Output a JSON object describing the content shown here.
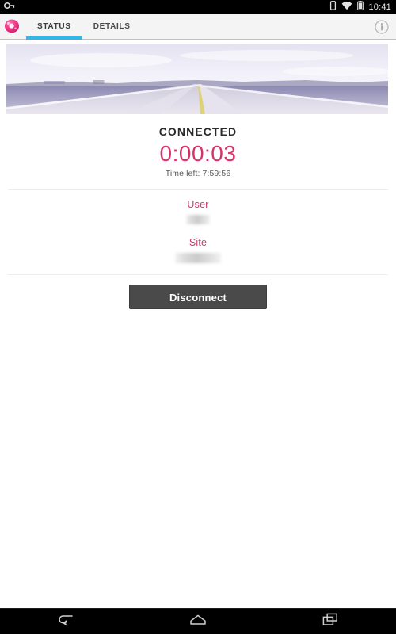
{
  "system": {
    "status_bar": {
      "left_icons": [
        {
          "name": "vpn-key-icon",
          "glyph": "vpn-key"
        }
      ],
      "right_icons": [
        {
          "name": "vibrate-mode-icon",
          "glyph": "vibrate"
        },
        {
          "name": "wifi-icon",
          "glyph": "wifi"
        },
        {
          "name": "battery-icon",
          "glyph": "battery"
        }
      ],
      "clock": "10:41"
    },
    "nav_bar": {
      "back_label": "Back",
      "home_label": "Home",
      "recents_label": "Recent apps"
    }
  },
  "app_bar": {
    "logo_name": "app-logo-icon",
    "logo_color": "#e8357f",
    "tabs": [
      {
        "label": "STATUS",
        "active": true
      },
      {
        "label": "DETAILS",
        "active": false
      }
    ],
    "info_button_label": "Info",
    "underline_color": "#e3aebe",
    "active_tab_indicator_color": "#33b5e5"
  },
  "main": {
    "banner": {
      "name": "desert-highway-banner",
      "alt": "Empty desert highway stretching to the horizon"
    },
    "status": {
      "label": "CONNECTED",
      "timer": "0:00:03",
      "time_left": "Time left: 7:59:56",
      "accent_color": "#d6336c"
    },
    "fields": [
      {
        "label": "User",
        "value": "",
        "redacted": true,
        "name": "user"
      },
      {
        "label": "Site",
        "value": "",
        "redacted": true,
        "name": "site"
      }
    ],
    "action": {
      "disconnect_label": "Disconnect",
      "button_color": "#4a4a4a"
    }
  }
}
